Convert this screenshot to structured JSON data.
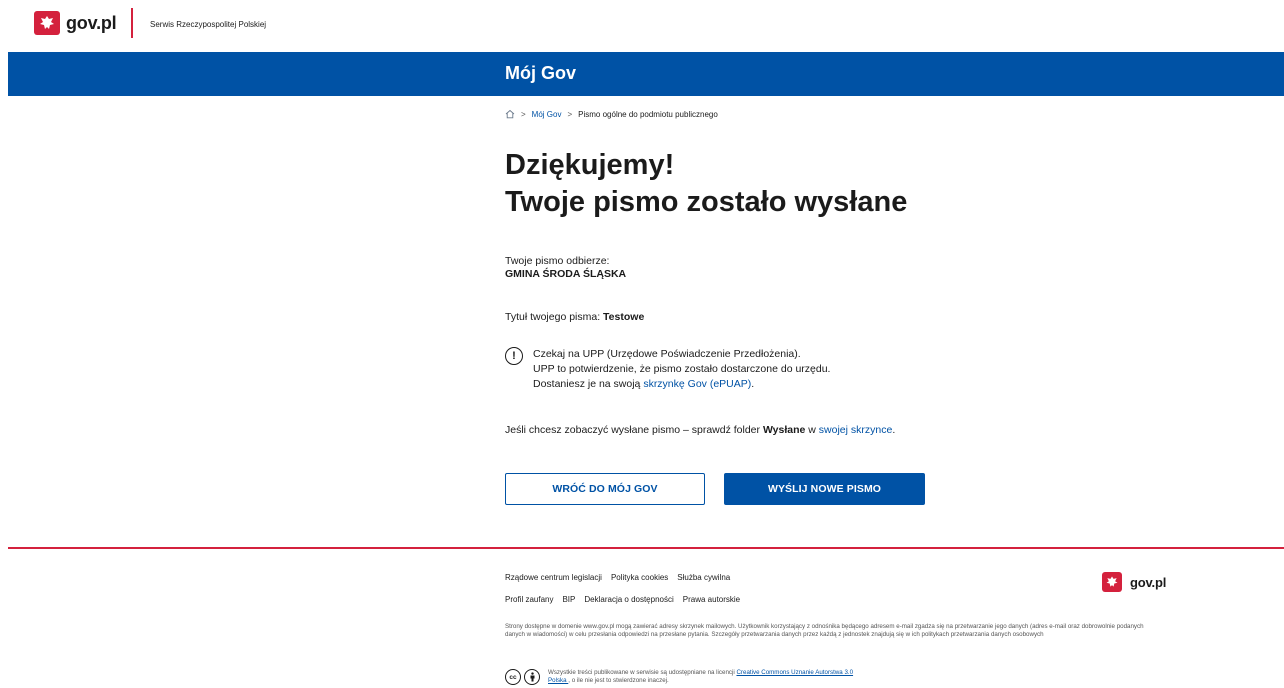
{
  "header": {
    "logo_text": "gov.pl",
    "service": "Serwis Rzeczypospolitej Polskiej"
  },
  "banner": {
    "title": "Mój Gov"
  },
  "breadcrumb": {
    "items": [
      "Mój Gov",
      "Pismo ogólne do podmiotu publicznego"
    ]
  },
  "main": {
    "heading_line1": "Dziękujemy!",
    "heading_line2": "Twoje pismo zostało wysłane",
    "recipient_label": "Twoje pismo odbierze:",
    "recipient_value": "GMINA ŚRODA ŚLĄSKA",
    "title_label": "Tytuł twojego pisma: ",
    "title_value": "Testowe",
    "info_line1": "Czekaj na UPP (Urzędowe Poświadczenie Przedłożenia).",
    "info_line2": "UPP to potwierdzenie, że pismo zostało dostarczone do urzędu.",
    "info_line3_prefix": "Dostaniesz je na swoją ",
    "info_line3_link": "skrzynkę Gov (ePUAP)",
    "info_line3_suffix": ".",
    "check_prefix": "Jeśli chcesz zobaczyć wysłane pismo – sprawdź folder ",
    "check_bold": "Wysłane",
    "check_mid": " w ",
    "check_link": "swojej skrzynce",
    "check_suffix": "."
  },
  "buttons": {
    "back": "WRÓĆ DO MÓJ GOV",
    "new": "WYŚLIJ NOWE PISMO"
  },
  "footer": {
    "links_row1": [
      "Rządowe centrum legislacji",
      "Polityka cookies",
      "Służba cywilna"
    ],
    "links_row2": [
      "Profil zaufany",
      "BIP",
      "Deklaracja o dostępności",
      "Prawa autorskie"
    ],
    "logo_text": "gov.pl",
    "privacy": "Strony dostępne w domenie www.gov.pl mogą zawierać adresy skrzynek mailowych. Użytkownik korzystający z odnośnika będącego adresem e-mail zgadza się na przetwarzanie jego danych (adres e-mail oraz dobrowolnie podanych danych w wiadomości) w celu przesłania odpowiedzi na przesłane pytania. Szczegóły przetwarzania danych przez każdą z jednostek znajdują się w ich politykach przetwarzania danych osobowych",
    "license_prefix": "Wszystkie treści publikowane w serwisie są udostępniane na licencji ",
    "license_link": "Creative Commons Uznanie Autorstwa 3.0 Polska ",
    "license_suffix": ", o ile nie jest to stwierdzone inaczej.",
    "cc_label": "cc"
  },
  "colors": {
    "primary": "#0052a5",
    "accent_red": "#d4213d",
    "text": "#1b1b1b"
  }
}
